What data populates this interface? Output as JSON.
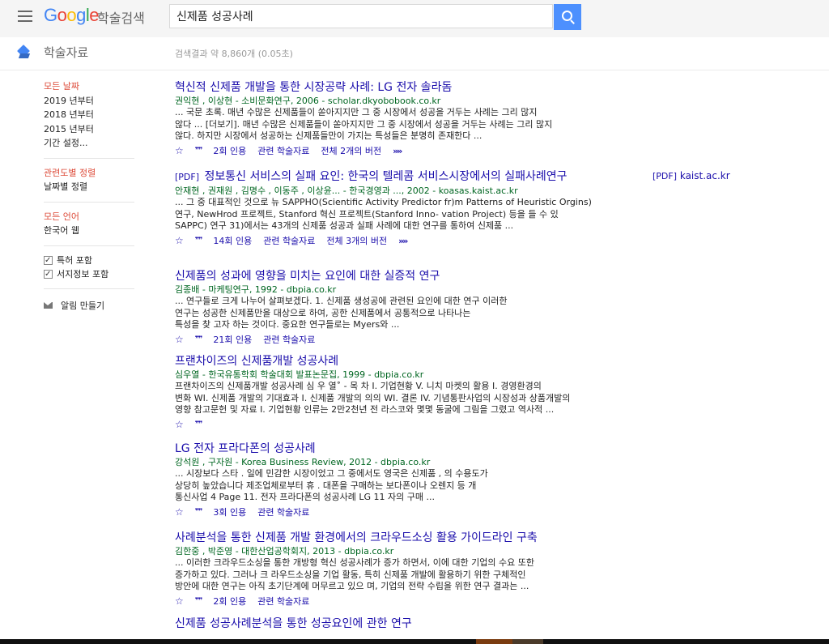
{
  "header": {
    "logo_google": "Google",
    "logo_sub": "학술검색",
    "search_value": "신제품 성공사례"
  },
  "subheader": {
    "section_title": "학술자료",
    "result_stats": "검색결과 약 8,860개 (0.05초)"
  },
  "sidebar": {
    "date_items": [
      "모든 날짜",
      "2019 년부터",
      "2018 년부터",
      "2015 년부터",
      "기간 설정..."
    ],
    "sort_items": [
      "관련도별 정렬",
      "날짜별 정렬"
    ],
    "lang_items": [
      "모든 언어",
      "한국어 웹"
    ],
    "checks": [
      "특허 포함",
      "서지정보 포함"
    ],
    "alert": "알림 만들기"
  },
  "side_links": [
    {
      "tag": "[PDF]",
      "text": "kaist.ac.kr"
    }
  ],
  "results": [
    {
      "title": "혁신적 신제품 개발을 통한 시장공략 사례: LG 전자 솔라돔",
      "meta": "권익현 , 이상현 - 소비문화연구, 2006 - scholar.dkyobobook.co.kr",
      "snippet": [
        "... 국문 초록. 매년 수많은 신제품들이 쏟아지지만 그 중 시장에서 성공을 거두는 사례는 그리 많지",
        "않다 ... [더보기]. 매년 수많은 신제품들이 쏟아지지만 그 중 시장에서 성공을 거두는 사례는 그리 많지",
        "않다. 하지만 시장에서 성공하는 신제품들만이 가지는 특성들은 분명히 존재한다 ..."
      ],
      "cited": "2회 인용",
      "related": "관련 학술자료",
      "versions": "전체 2개의 버전"
    },
    {
      "tag": "[PDF]",
      "title": "정보통신 서비스의 실패 요인: 한국의 텔레콤 서비스시장에서의 실패사례연구",
      "meta": "안재현 , 권재원 , 김명수 , 이동주 , 이상윤... - 한국경영과 ..., 2002 - koasas.kaist.ac.kr",
      "snippet": [
        "... 그 중 대표적인 것으로 뉴 SAPPHO(Scientific Activity Predictor fr)m Patterns of Heuristic Orgins)",
        "연구, NewHrod 프로젝트, Stanford 혁신 프로젝트(Stanford Inno- vation Project) 등을 들 수 있",
        "SAPPC) 연구 31)에서는 43개의 신제품 성공과 실패 사례에 대한 연구를 통하여 신제품 ..."
      ],
      "cited": "14회 인용",
      "related": "관련 학술자료",
      "versions": "전체 3개의 버전"
    },
    {
      "title": "신제품의 성과에 영향을 미치는 요인에 대한 실증적 연구",
      "meta": "김종배 - 마케팅연구, 1992 - dbpia.co.kr",
      "snippet": [
        "... 연구들로 크게 나누어 살펴보겠다. 1. 신제품 생성공에 관련된 요인에 대한 연구 이러한",
        "연구는 성공한 신제품만을 대상으로 하여, 공한 신제품에서 공통적으로 나타나는",
        "특성을 찾 고자 하는 것이다. 중요한 연구들로는 Myers와 ..."
      ],
      "cited": "21회 인용",
      "related": "관련 학술자료",
      "versions": ""
    },
    {
      "title": "프랜차이즈의 신제품개발 성공사례",
      "meta": "심우열 - 한국유통학회 학술대회 발표논문집, 1999 - dbpia.co.kr",
      "snippet": [
        "프랜차이즈의 신제품개발 성공사례 심 우 열˚ - 목 차 I. 기업현황 V. 니치 마켓의 활용 I. 경영환경의",
        "변화 WI. 신제품 개발의 기대효과 I. 신제품 개발의 의의 WI. 결론 IV. 기념통판사업의 시장성과 상품개발의",
        "영향 참고문헌 및 자료 I. 기업현황 인류는 2만2천년 전 라스코와 몇몇 동굴에 그림을 그렸고 역사적 ..."
      ],
      "cited": "",
      "related": "",
      "versions": ""
    },
    {
      "title": "LG 전자 프라다폰의 성공사례",
      "meta": "강석원 , 구자원 - Korea Business Review, 2012 - dbpia.co.kr",
      "snippet": [
        "... 시장보다 스타 . 일에 민감한 시장이었고 그 중에서도 영국은 신제품 , 의 수용도가",
        "상당히 높았습니다 제조업체로부터 휴 . 대폰을 구매하는 보다폰이나 오렌지 등 개",
        "통신사업 4 Page 11. 전자 프라다폰의 성공사례 LG 11 자의 구매 ..."
      ],
      "cited": "3회 인용",
      "related": "관련 학술자료",
      "versions": ""
    },
    {
      "title": "사례분석을 통한 신제품 개발 환경에서의 크라우드소싱 활용 가이드라인 구축",
      "meta": "김한중 , 박준영 - 대한산업공학회지, 2013 - dbpia.co.kr",
      "snippet": [
        "... 이러한 크라우드소싱을 통한 개방형 혁신 성공사례가 증가 하면서, 이에 대한 기업의 수요 또한",
        "증가하고 있다. 그러나 크 라우드소싱을 기업 활동, 특히 신제품 개발에 활용하기 위한 구체적인",
        "방안에 대한 연구는 아직 초기단계에 머무르고 있으 며, 기업의 전략 수립을 위한 연구 결과는 ..."
      ],
      "cited": "2회 인용",
      "related": "관련 학술자료",
      "versions": ""
    },
    {
      "title": "신제품 성공사례분석을 통한 성공요인에 관한 연구",
      "meta": "",
      "snippet": [],
      "cited": "",
      "related": "",
      "versions": ""
    }
  ]
}
